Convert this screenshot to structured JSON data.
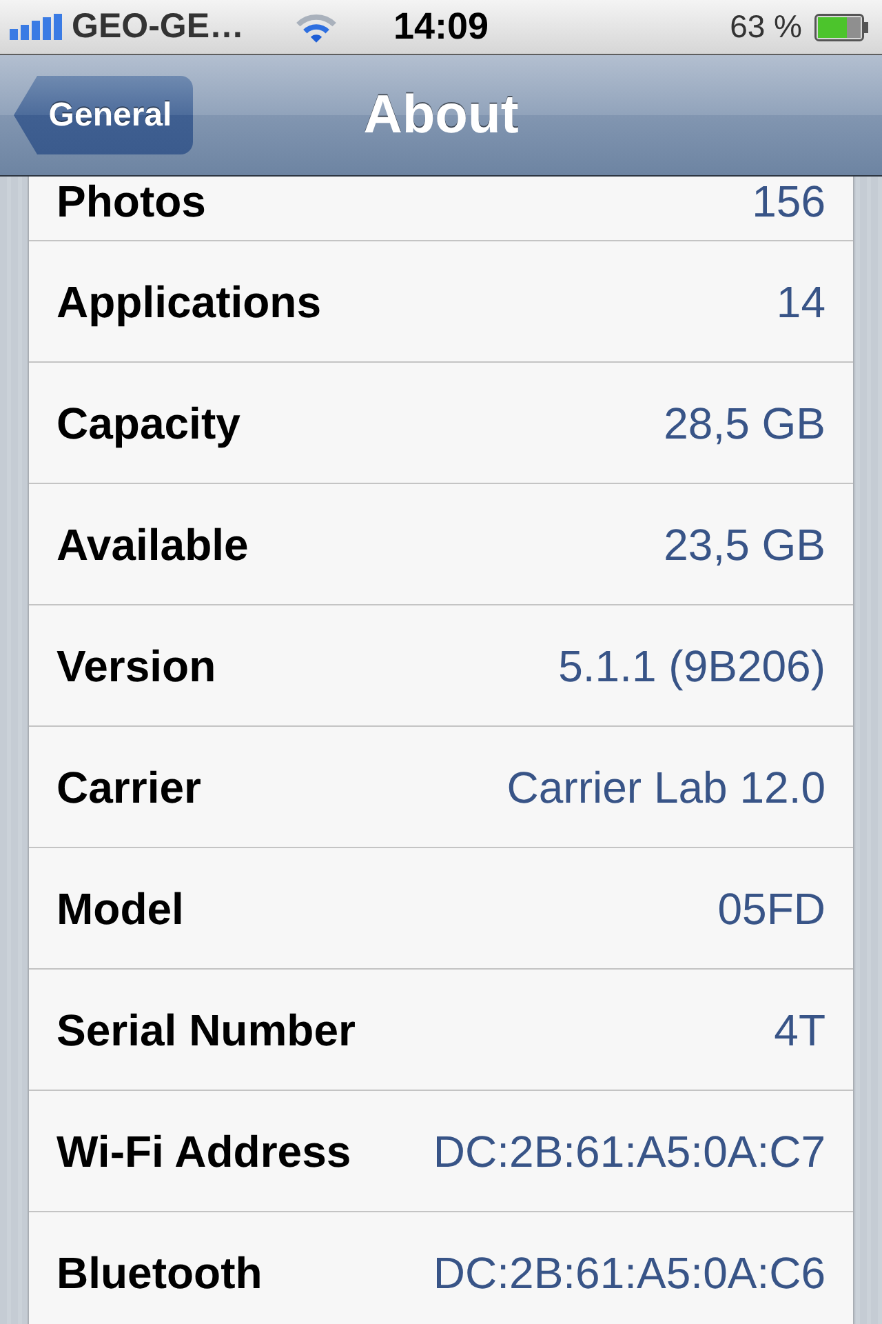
{
  "status_bar": {
    "carrier": "GEO-GE…",
    "time": "14:09",
    "battery": "63 %"
  },
  "nav_bar": {
    "back_button": "General",
    "title": "About"
  },
  "rows": [
    {
      "label": "Photos",
      "value": "156"
    },
    {
      "label": "Applications",
      "value": "14"
    },
    {
      "label": "Capacity",
      "value": "28,5 GB"
    },
    {
      "label": "Available",
      "value": "23,5 GB"
    },
    {
      "label": "Version",
      "value": "5.1.1 (9B206)"
    },
    {
      "label": "Carrier",
      "value": "Carrier Lab 12.0"
    },
    {
      "label": "Model",
      "value": "05FD"
    },
    {
      "label": "Serial Number",
      "value": "4T"
    },
    {
      "label": "Wi-Fi Address",
      "value": "DC:2B:61:A5:0A:C7"
    },
    {
      "label": "Bluetooth",
      "value": "DC:2B:61:A5:0A:C6"
    }
  ]
}
